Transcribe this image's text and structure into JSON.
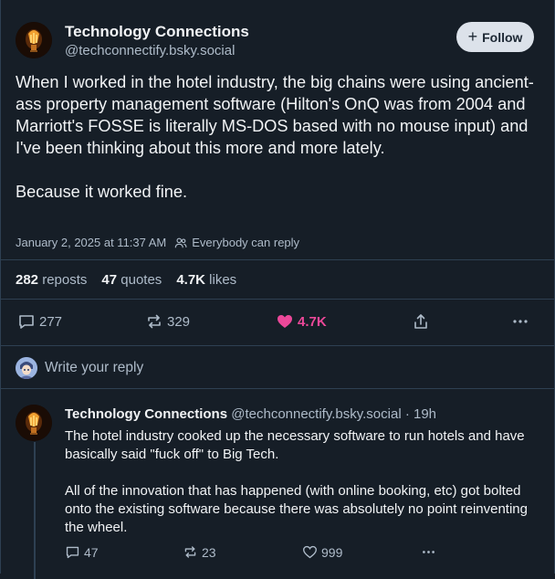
{
  "post": {
    "author": {
      "display_name": "Technology Connections",
      "handle": "@techconnectify.bsky.social"
    },
    "follow_label": "Follow",
    "text": "When I worked in the hotel industry, the big chains were using ancient-ass property management software (Hilton's OnQ was from 2004 and Marriott's FOSSE is literally MS-DOS based with no mouse input) and I've been thinking about this more and more lately.\n\nBecause it worked fine.",
    "timestamp": "January 2, 2025 at 11:37 AM",
    "reply_setting": "Everybody can reply",
    "stats": {
      "reposts_count": "282",
      "reposts_label": "reposts",
      "quotes_count": "47",
      "quotes_label": "quotes",
      "likes_count": "4.7K",
      "likes_label": "likes"
    },
    "actions": {
      "replies": "277",
      "reposts": "329",
      "likes": "4.7K"
    }
  },
  "composer": {
    "placeholder": "Write your reply"
  },
  "reply": {
    "display_name": "Technology Connections",
    "handle_time": "@techconnectify.bsky.social · 19h",
    "text": "The hotel industry cooked up the necessary software to run hotels and have basically said \"fuck off\" to Big Tech.\n\nAll of the innovation that has happened (with online booking, etc) got bolted onto the existing software because there was absolutely no point reinventing the wheel.",
    "actions": {
      "replies": "47",
      "reposts": "23",
      "likes": "999"
    }
  },
  "icons": {
    "follow": "plus-icon",
    "reply_setting": "people-icon",
    "reply": "speech-bubble-icon",
    "repost": "repost-arrows-icon",
    "like": "heart-icon",
    "share": "share-icon",
    "more": "ellipsis-icon"
  },
  "colors": {
    "background": "#161e27",
    "like_active": "#ec4899",
    "muted_text": "#aebbc9",
    "follow_button_bg": "#dce2ea"
  }
}
